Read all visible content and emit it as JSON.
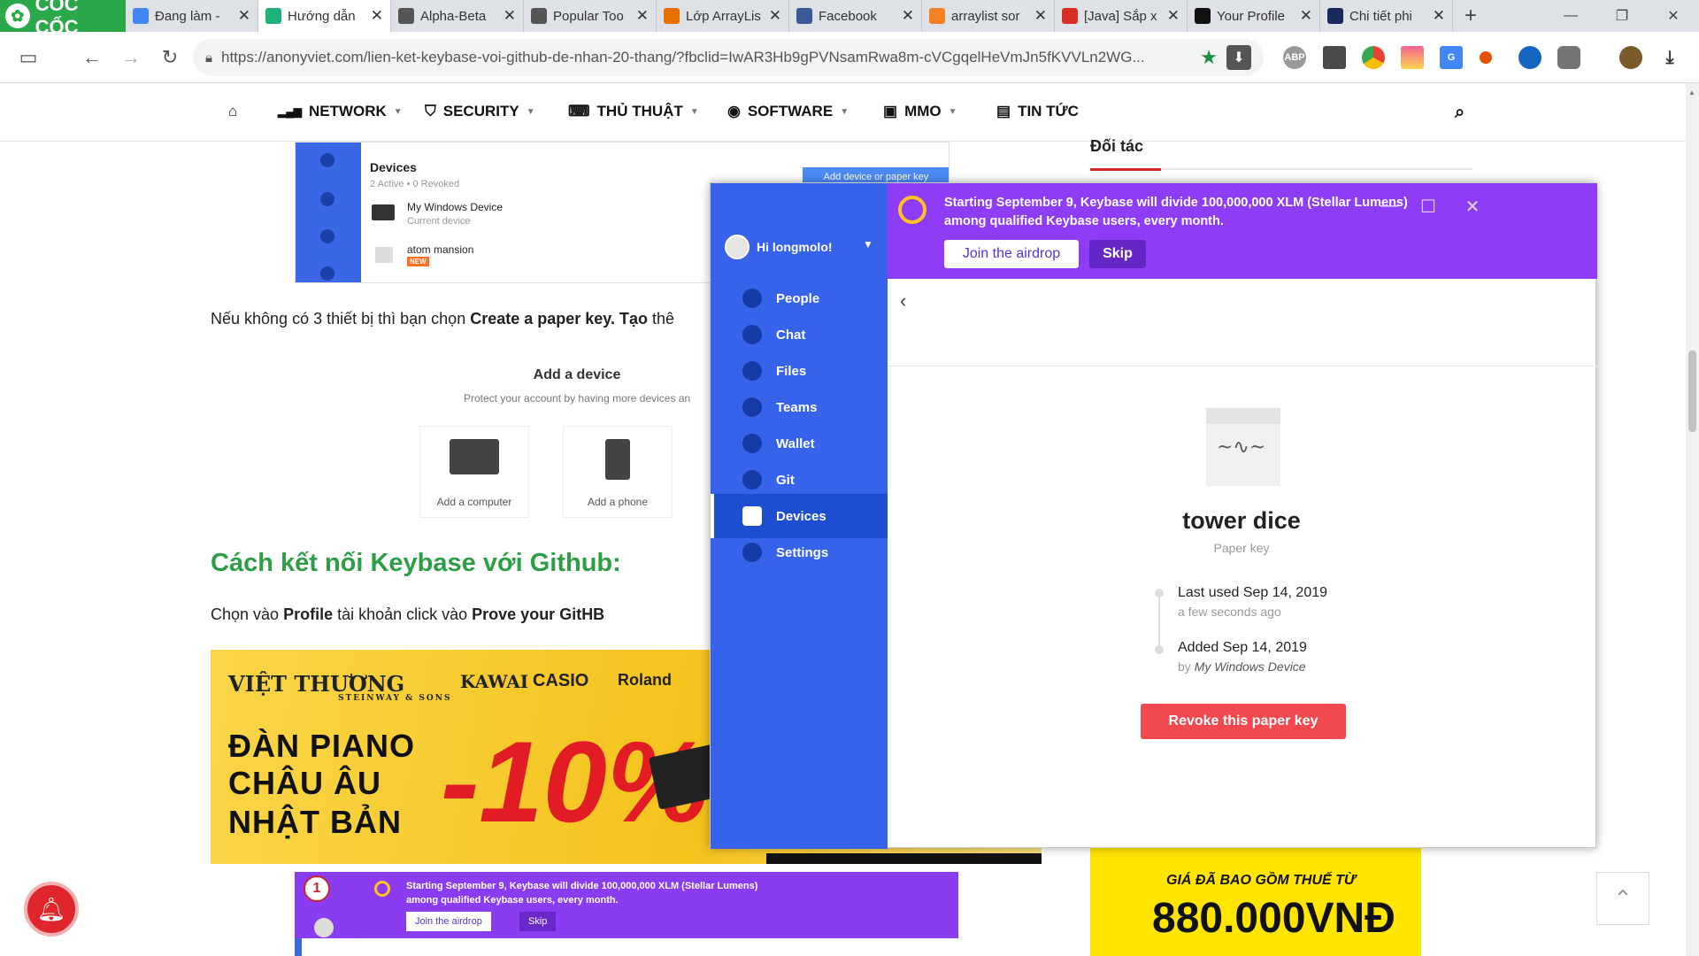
{
  "browser": {
    "brand": "CỐC CỐC",
    "tabs": [
      {
        "title": "Đang làm - ",
        "icon": "docs-icon",
        "color": "#4285f4",
        "active": false
      },
      {
        "title": "Hướng dẫn",
        "icon": "check-icon",
        "color": "#1fb37c",
        "active": true
      },
      {
        "title": "Alpha-Beta",
        "icon": "globe-icon",
        "color": "#555555",
        "active": false
      },
      {
        "title": "Popular Too",
        "icon": "globe-icon",
        "color": "#555555",
        "active": false
      },
      {
        "title": "Lớp ArrayLis",
        "icon": "java-icon",
        "color": "#e76f00",
        "active": false
      },
      {
        "title": "Facebook",
        "icon": "facebook-icon",
        "color": "#3b5998",
        "active": false
      },
      {
        "title": "arraylist sor",
        "icon": "stackoverflow-icon",
        "color": "#f48024",
        "active": false
      },
      {
        "title": "[Java] Sắp x",
        "icon": "s-icon",
        "color": "#d93025",
        "active": false
      },
      {
        "title": "Your Profile",
        "icon": "github-icon",
        "color": "#111111",
        "active": false
      },
      {
        "title": "Chi tiết phi",
        "icon": "lol-icon",
        "color": "#1a2a5c",
        "active": false
      }
    ],
    "url": "https://anonyviet.com/lien-ket-keybase-voi-github-de-nhan-20-thang/?fbclid=IwAR3Hb9gPVNsamRwa8m-cVCgqelHeVmJn5fKVVLn2WG..."
  },
  "site_nav": {
    "items": [
      "NETWORK",
      "SECURITY",
      "THỦ THUẬT",
      "SOFTWARE",
      "MMO",
      "TIN TỨC"
    ]
  },
  "article": {
    "shot1": {
      "title": "Devices",
      "subtitle": "2 Active • 0 Revoked",
      "device1": "My Windows Device",
      "device1_sub": "Current device",
      "device2": "atom mansion",
      "device2_badge": "NEW",
      "add_button": "Add device or paper key"
    },
    "para1_a": "Nếu không có 3 thiết bị thì bạn chọn ",
    "para1_b": "Create a paper key. Tạo",
    "para1_c": " thê",
    "add_device": {
      "title": "Add a device",
      "subtitle": "Protect your account by having more devices an",
      "computer": "Add a computer",
      "phone": "Add a phone"
    },
    "heading": "Cách kết nối Keybase với Github:",
    "para2_a": "Chọn vào ",
    "para2_b": "Profile",
    "para2_c": " tài khoản click vào ",
    "para2_d": "Prove your GitHB",
    "banner": {
      "brand1": "VIỆT THƯƠNG",
      "brand2": "STEINWAY & SONS",
      "brand3": "KAWAI",
      "brand4": "CASIO",
      "brand5": "Roland",
      "line1": "ĐÀN PIANO",
      "line2": "CHÂU ÂU",
      "line3": "NHẬT BẢN",
      "discount": "-10%"
    },
    "shot2": {
      "step": "1",
      "message": "Starting September 9, Keybase will divide 100,000,000 XLM (Stellar Lumens) among qualified Keybase users, every month.",
      "join": "Join the airdrop",
      "skip": "Skip"
    }
  },
  "sidebar": {
    "title": "Đối tác",
    "ad_line1": "GIÁ ĐÃ BAO GỒM THUẾ TỪ",
    "ad_line2": "880.000VNĐ"
  },
  "keybase": {
    "user": "Hi longmolo!",
    "nav": [
      {
        "label": "People",
        "icon": "people-icon",
        "active": false
      },
      {
        "label": "Chat",
        "icon": "chat-icon",
        "active": false
      },
      {
        "label": "Files",
        "icon": "files-icon",
        "active": false
      },
      {
        "label": "Teams",
        "icon": "teams-icon",
        "active": false
      },
      {
        "label": "Wallet",
        "icon": "wallet-icon",
        "active": false
      },
      {
        "label": "Git",
        "icon": "git-icon",
        "active": false
      },
      {
        "label": "Devices",
        "icon": "devices-icon",
        "active": true
      },
      {
        "label": "Settings",
        "icon": "settings-icon",
        "active": false
      }
    ],
    "banner_pre": "Starting September 9, Keybase will divide ",
    "banner_amount": "100,000,000 XLM",
    "banner_mid": " (Stellar Lumens) among qualified Keybase users, ",
    "banner_end": "every month.",
    "join": "Join the airdrop",
    "skip": "Skip",
    "device_name": "tower dice",
    "device_type": "Paper key",
    "last_used": "Last used Sep 14, 2019",
    "last_used_sub": "a few seconds ago",
    "added": "Added Sep 14, 2019",
    "added_by_prefix": "by ",
    "added_by": "My Windows Device",
    "revoke": "Revoke this paper key",
    "colors": {
      "sidebar": "#3663ea",
      "banner": "#8e3cf6",
      "revoke": "#f2484f"
    }
  }
}
